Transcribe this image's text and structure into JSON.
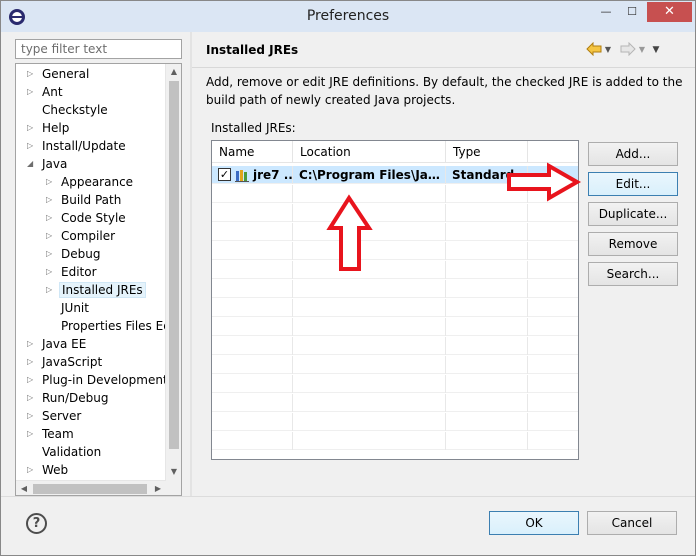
{
  "window": {
    "title": "Preferences",
    "minimize_glyph": "—",
    "maximize_glyph": "☐",
    "close_glyph": "✕"
  },
  "filter": {
    "placeholder": "type filter text"
  },
  "tree": {
    "items": [
      {
        "label": "General",
        "level": 0,
        "expander": "collapsed"
      },
      {
        "label": "Ant",
        "level": 0,
        "expander": "collapsed"
      },
      {
        "label": "Checkstyle",
        "level": 0,
        "expander": "none"
      },
      {
        "label": "Help",
        "level": 0,
        "expander": "collapsed"
      },
      {
        "label": "Install/Update",
        "level": 0,
        "expander": "collapsed"
      },
      {
        "label": "Java",
        "level": 0,
        "expander": "expanded"
      },
      {
        "label": "Appearance",
        "level": 1,
        "expander": "collapsed"
      },
      {
        "label": "Build Path",
        "level": 1,
        "expander": "collapsed"
      },
      {
        "label": "Code Style",
        "level": 1,
        "expander": "collapsed"
      },
      {
        "label": "Compiler",
        "level": 1,
        "expander": "collapsed"
      },
      {
        "label": "Debug",
        "level": 1,
        "expander": "collapsed"
      },
      {
        "label": "Editor",
        "level": 1,
        "expander": "collapsed"
      },
      {
        "label": "Installed JREs",
        "level": 1,
        "expander": "collapsed",
        "selected": true
      },
      {
        "label": "JUnit",
        "level": 1,
        "expander": "none"
      },
      {
        "label": "Properties Files Edito",
        "level": 1,
        "expander": "none"
      },
      {
        "label": "Java EE",
        "level": 0,
        "expander": "collapsed"
      },
      {
        "label": "JavaScript",
        "level": 0,
        "expander": "collapsed"
      },
      {
        "label": "Plug-in Development",
        "level": 0,
        "expander": "collapsed"
      },
      {
        "label": "Run/Debug",
        "level": 0,
        "expander": "collapsed"
      },
      {
        "label": "Server",
        "level": 0,
        "expander": "collapsed"
      },
      {
        "label": "Team",
        "level": 0,
        "expander": "collapsed"
      },
      {
        "label": "Validation",
        "level": 0,
        "expander": "none"
      },
      {
        "label": "Web",
        "level": 0,
        "expander": "collapsed"
      }
    ]
  },
  "page": {
    "title": "Installed JREs",
    "description": "Add, remove or edit JRE definitions. By default, the checked JRE is added to the build path of newly created Java projects.",
    "table_label": "Installed JREs:",
    "columns": [
      "Name",
      "Location",
      "Type"
    ],
    "rows": [
      {
        "checked": true,
        "name": "jre7 ...",
        "location": "C:\\Program Files\\Java\\j...",
        "type": "Standard ..."
      }
    ],
    "buttons": {
      "add": "Add...",
      "edit": "Edit...",
      "duplicate": "Duplicate...",
      "remove": "Remove",
      "search": "Search..."
    }
  },
  "dialog": {
    "help_glyph": "?",
    "ok": "OK",
    "cancel": "Cancel"
  },
  "icons": {
    "nav_back": "nav-back-icon",
    "nav_forward": "nav-forward-icon",
    "view_menu": "view-menu-icon",
    "jre": "jre-library-icon"
  },
  "colors": {
    "annotation_arrow": "#e8141d",
    "selection": "#cce8ff",
    "titlebar": "#dbe6f4",
    "close_button": "#c75050"
  }
}
